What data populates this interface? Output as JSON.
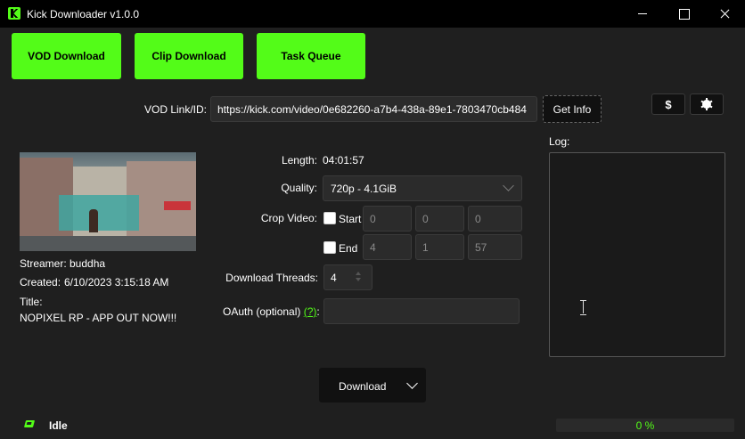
{
  "window": {
    "title": "Kick Downloader v1.0.0"
  },
  "nav": {
    "vod": "VOD Download",
    "clip": "Clip Download",
    "queue": "Task Queue"
  },
  "link": {
    "label": "VOD Link/ID:",
    "value": "https://kick.com/video/0e682260-a7b4-438a-89e1-7803470cb484",
    "get_info": "Get Info"
  },
  "toolbar": {
    "donate_symbol": "$"
  },
  "info": {
    "streamer_label": "Streamer:",
    "streamer": "buddha",
    "created_label": "Created:",
    "created": "6/10/2023 3:15:18 AM",
    "title_label": "Title:",
    "title": "NOPIXEL RP - APP OUT NOW!!!"
  },
  "options": {
    "length_label": "Length:",
    "length": "04:01:57",
    "quality_label": "Quality:",
    "quality": "720p - 4.1GiB",
    "crop_label": "Crop Video:",
    "start_label": "Start",
    "start": [
      "0",
      "0",
      "0"
    ],
    "end_label": "End",
    "end": [
      "4",
      "1",
      "57"
    ],
    "threads_label": "Download Threads:",
    "threads": "4",
    "oauth_label": "OAuth (optional)",
    "oauth_help": "(?)",
    "oauth_colon": ":",
    "oauth_value": ""
  },
  "log": {
    "label": "Log:"
  },
  "download": {
    "label": "Download"
  },
  "status": {
    "text": "Idle",
    "progress_text": "0 %",
    "progress": 0
  },
  "colors": {
    "accent": "#53fc18",
    "background": "#1f1f1f"
  }
}
